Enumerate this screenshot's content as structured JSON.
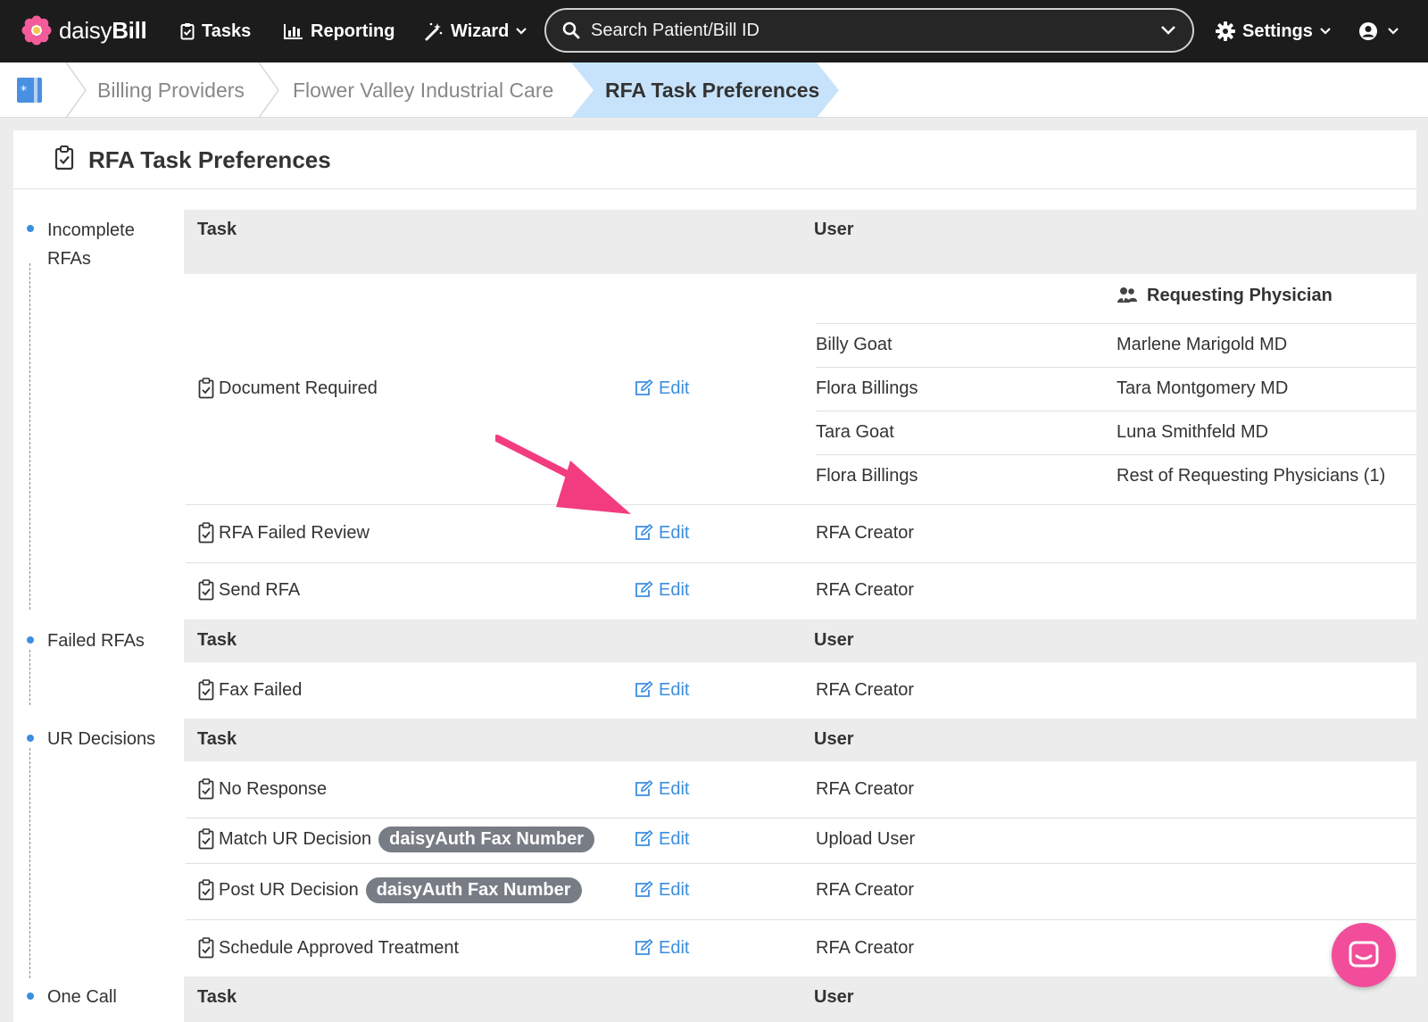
{
  "nav": {
    "brand_light": "daisy",
    "brand_bold": "Bill",
    "tasks": "Tasks",
    "reporting": "Reporting",
    "wizard": "Wizard",
    "search_placeholder": "Search Patient/Bill ID",
    "settings": "Settings"
  },
  "breadcrumb": {
    "items": [
      "Billing Providers",
      "Flower Valley Industrial Care",
      "RFA Task Preferences"
    ]
  },
  "page": {
    "title": "RFA Task Preferences"
  },
  "sidenav": [
    "Incomplete RFAs",
    "Failed RFAs",
    "UR Decisions",
    "One Call"
  ],
  "headers": {
    "task": "Task",
    "user": "User"
  },
  "incomplete": {
    "physician_header": "Requesting Physician",
    "document_required": {
      "task": "Document Required",
      "edit": "Edit",
      "rows": [
        {
          "user": "Billy Goat",
          "physician": "Marlene Marigold MD"
        },
        {
          "user": "Flora Billings",
          "physician": "Tara Montgomery MD"
        },
        {
          "user": "Tara Goat",
          "physician": "Luna Smithfeld MD"
        },
        {
          "user": "Flora Billings",
          "physician": "Rest of Requesting Physicians (1)"
        }
      ]
    },
    "rfa_failed_review": {
      "task": "RFA Failed Review",
      "edit": "Edit",
      "user": "RFA Creator"
    },
    "send_rfa": {
      "task": "Send RFA",
      "edit": "Edit",
      "user": "RFA Creator"
    }
  },
  "failed": {
    "fax_failed": {
      "task": "Fax Failed",
      "edit": "Edit",
      "user": "RFA Creator"
    }
  },
  "ur": {
    "no_response": {
      "task": "No Response",
      "edit": "Edit",
      "user": "RFA Creator"
    },
    "match_ur": {
      "task": "Match UR Decision",
      "badge": "daisyAuth Fax Number",
      "edit": "Edit",
      "user": "Upload User"
    },
    "post_ur": {
      "task": "Post UR Decision",
      "badge": "daisyAuth Fax Number",
      "edit": "Edit",
      "user": "RFA Creator"
    },
    "schedule": {
      "task": "Schedule Approved Treatment",
      "edit": "Edit",
      "user": "RFA Creator"
    }
  },
  "colors": {
    "nav_bg": "#1c1c1c",
    "accent_blue": "#3b8ee0",
    "active_crumb": "#c7e3fb",
    "badge_grey": "#777c85",
    "chat_pink": "#f14d9a",
    "arrow_pink": "#f23c7f"
  }
}
